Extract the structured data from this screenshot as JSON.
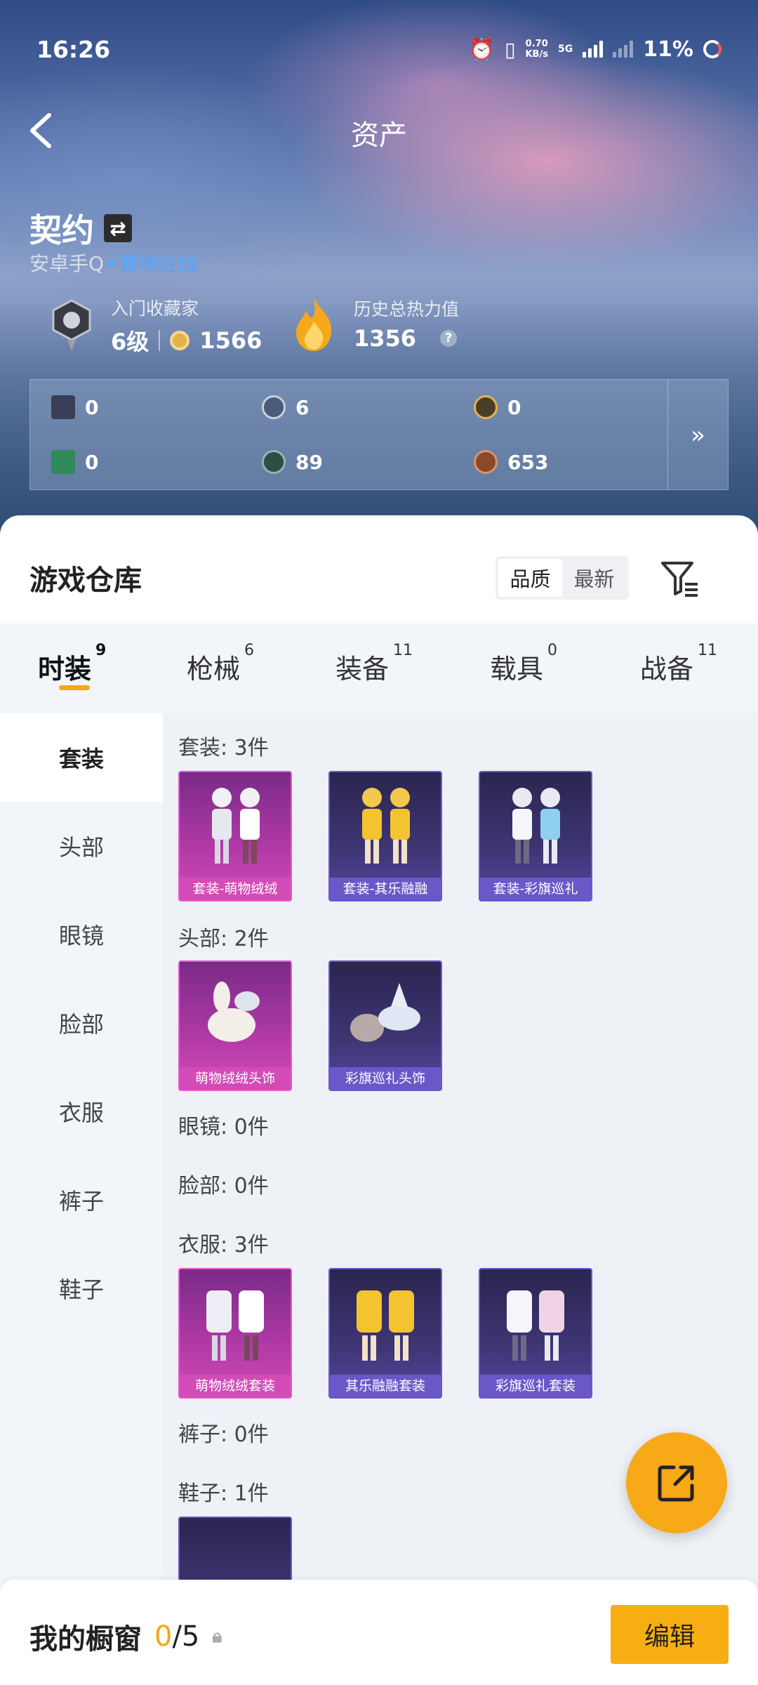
{
  "status": {
    "time": "16:26",
    "speed": "0.70",
    "speed_unit": "KB/s",
    "network": "5G",
    "battery": "11%"
  },
  "header": {
    "title": "资产"
  },
  "user": {
    "name": "契约",
    "platform": "安卓手Q",
    "online": "营地在线"
  },
  "collector": {
    "label": "入门收藏家",
    "level": "6级",
    "points": "1566"
  },
  "heat": {
    "label": "历史总热力值",
    "value": "1356",
    "help": "?"
  },
  "assets": [
    {
      "icon": "card-icon",
      "value": "0"
    },
    {
      "icon": "silver-coin-icon",
      "value": "6"
    },
    {
      "icon": "gold-coin-icon",
      "value": "0"
    },
    {
      "icon": "ticket-icon",
      "value": "0"
    },
    {
      "icon": "green-orb-icon",
      "value": "89"
    },
    {
      "icon": "bronze-coin-icon",
      "value": "653"
    }
  ],
  "more": "»",
  "warehouse": {
    "title": "游戏仓库",
    "sort": [
      "品质",
      "最新"
    ],
    "tabs": [
      {
        "label": "时装",
        "count": "9"
      },
      {
        "label": "枪械",
        "count": "6"
      },
      {
        "label": "装备",
        "count": "11"
      },
      {
        "label": "载具",
        "count": "0"
      },
      {
        "label": "战备",
        "count": "11"
      }
    ],
    "categories": [
      "套装",
      "头部",
      "眼镜",
      "脸部",
      "衣服",
      "裤子",
      "鞋子"
    ],
    "sections": [
      {
        "title": "套装: 3件",
        "items": [
          "套装-萌物绒绒",
          "套装-其乐融融",
          "套装-彩旗巡礼"
        ]
      },
      {
        "title": "头部: 2件",
        "items": [
          "萌物绒绒头饰",
          "彩旗巡礼头饰"
        ]
      },
      {
        "title": "眼镜: 0件",
        "items": []
      },
      {
        "title": "脸部: 0件",
        "items": []
      },
      {
        "title": "衣服: 3件",
        "items": [
          "萌物绒绒套装",
          "其乐融融套装",
          "彩旗巡礼套装"
        ]
      },
      {
        "title": "裤子: 0件",
        "items": []
      },
      {
        "title": "鞋子: 1件",
        "items": [
          ""
        ]
      }
    ]
  },
  "showcase": {
    "label": "我的橱窗",
    "current": "0",
    "total": "/5",
    "edit": "编辑"
  }
}
